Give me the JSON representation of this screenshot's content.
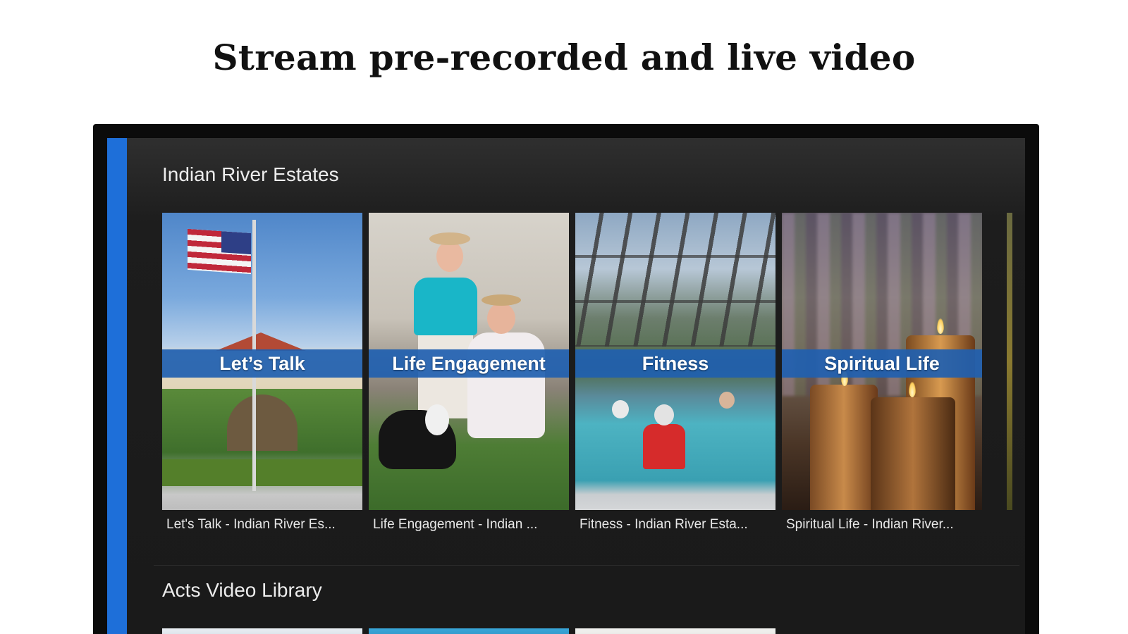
{
  "headline": "Stream pre-recorded and live video",
  "rows": [
    {
      "title": "Indian River Estates",
      "cards": [
        {
          "banner": "Let’s Talk",
          "caption": "Let's Talk - Indian River Es..."
        },
        {
          "banner": "Life Engagement",
          "caption": "Life Engagement - Indian ..."
        },
        {
          "banner": "Fitness",
          "caption": "Fitness - Indian River Esta..."
        },
        {
          "banner": "Spiritual Life",
          "caption": "Spiritual Life - Indian River..."
        }
      ]
    },
    {
      "title": "Acts Video Library"
    }
  ],
  "colors": {
    "focus_accent": "#1e6fd9",
    "banner": "#2060b0",
    "screen_bg": "#1a1a1a"
  }
}
